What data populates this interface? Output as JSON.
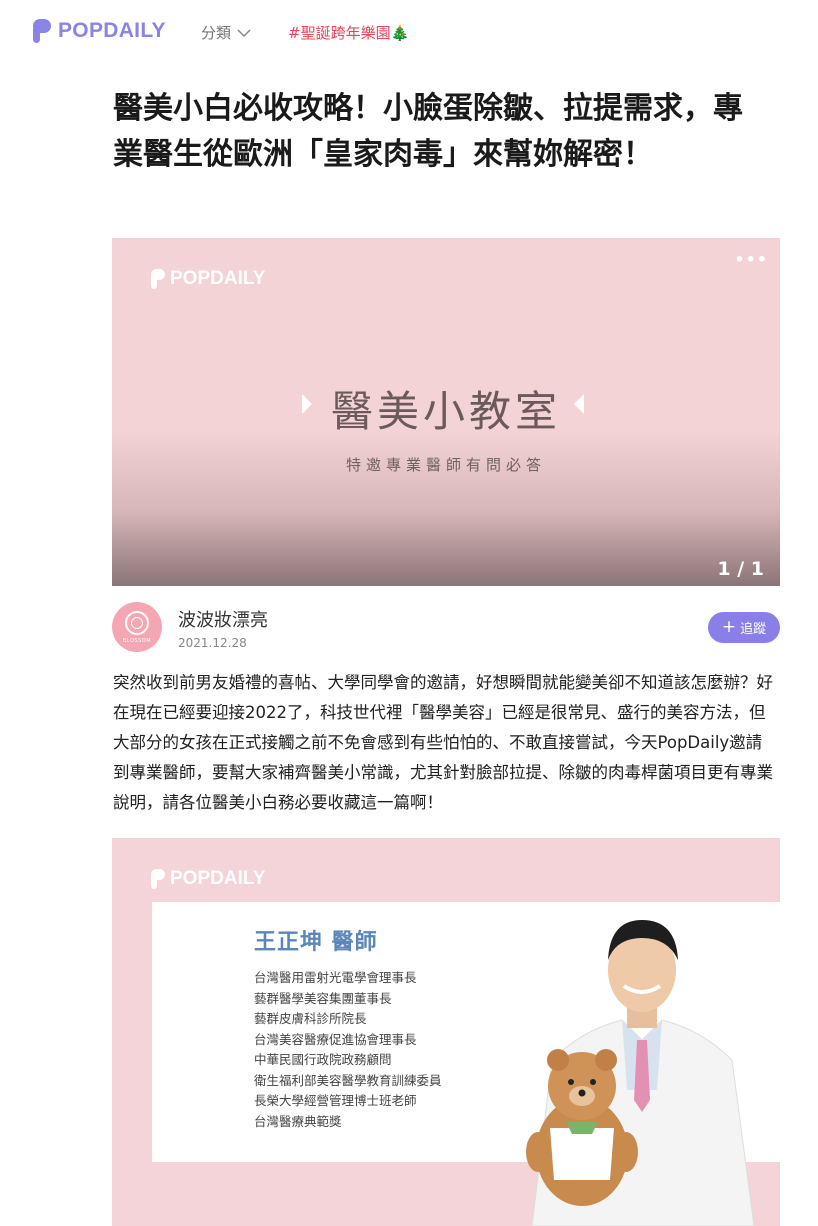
{
  "header": {
    "logo_text": "POPDAILY",
    "category_label": "分類",
    "featured_tag": "#聖誕跨年樂園🎄"
  },
  "article": {
    "title": "醫美小白必收攻略！小臉蛋除皺、拉提需求，專業醫生從歐洲「皇家肉毒」來幫妳解密！",
    "hero": {
      "logo_text": "POPDAILY",
      "headline": "醫美小教室",
      "subtitle": "特邀專業醫師有問必答",
      "counter": "1 / 1",
      "more_label": "•••"
    },
    "author": {
      "name": "波波妝漂亮",
      "date": "2021.12.28",
      "avatar_brand": "BLOSSOM",
      "follow_label": "追蹤"
    },
    "body": "突然收到前男友婚禮的喜帖、大學同學會的邀請，好想瞬間就能變美卻不知道該怎麼辦？好在現在已經要迎接2022了，科技世代裡「醫學美容」已經是很常見、盛行的美容方法，但大部分的女孩在正式接觸之前不免會感到有些怕怕的、不敢直接嘗試，今天PopDaily邀請到專業醫師，要幫大家補齊醫美小常識，尤其針對臉部拉提、除皺的肉毒桿菌項目更有專業說明，請各位醫美小白務必要收藏這一篇啊！",
    "image2": {
      "logo_text": "POPDAILY",
      "doctor_name": "王正坤 醫師",
      "credentials": [
        "台灣醫用雷射光電學會理事長",
        "藝群醫學美容集團董事長",
        "藝群皮膚科診所院長",
        "台灣美容醫療促進協會理事長",
        "中華民國行政院政務顧問",
        "衛生福利部美容醫學教育訓練委員",
        "長榮大學經營管理博士班老師",
        "台灣醫療典範獎"
      ]
    }
  },
  "colors": {
    "brand": "#8b83e6",
    "tag": "#e8445a",
    "follow_button": "#8a7fe8",
    "hero_pink": "#f3d3d6",
    "doctor_name_blue": "#5a86b8"
  }
}
